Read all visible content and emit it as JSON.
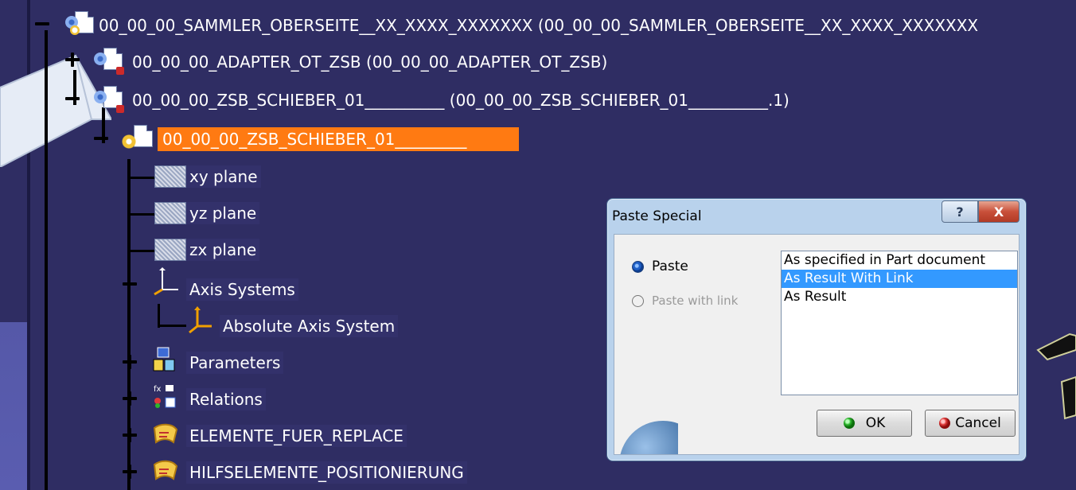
{
  "tree": {
    "root_label": "00_00_00_SAMMLER_OBERSEITE__XX_XXXX_XXXXXXX (00_00_00_SAMMLER_OBERSEITE__XX_XXXX_XXXXXXX",
    "adapter_label": "00_00_00_ADAPTER_OT_ZSB (00_00_00_ADAPTER_OT_ZSB)",
    "schieber_product_label": "00_00_00_ZSB_SCHIEBER_01__________ (00_00_00_ZSB_SCHIEBER_01__________.1)",
    "schieber_part_label": "00_00_00_ZSB_SCHIEBER_01_________",
    "xy_plane": "xy plane",
    "yz_plane": "yz plane",
    "zx_plane": "zx plane",
    "axis_systems": "Axis Systems",
    "absolute_axis_system": "Absolute Axis System",
    "parameters": "Parameters",
    "relations": "Relations",
    "elemente_fuer_replace": "ELEMENTE_FUER_REPLACE",
    "hilfselemente": "HILFSELEMENTE_POSITIONIERUNG"
  },
  "dialog": {
    "title": "Paste Special",
    "help_glyph": "?",
    "close_glyph": "X",
    "radio_paste": "Paste",
    "radio_paste_with_link": "Paste with link",
    "list_items": [
      "As specified in Part document",
      "As Result With Link",
      "As Result"
    ],
    "selected_index": 1,
    "ok_label": "OK",
    "cancel_label": "Cancel"
  },
  "colors": {
    "background": "#2f2d63",
    "selection": "#ff7a12",
    "list_selection": "#3399ff"
  }
}
